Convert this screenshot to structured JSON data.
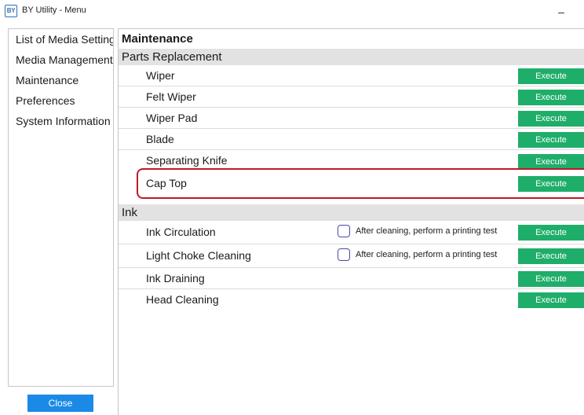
{
  "window": {
    "logo_text": "BY",
    "title": "BY Utility - Menu",
    "minimize_glyph": "–"
  },
  "sidebar": {
    "items": [
      {
        "label": "List of Media Settings"
      },
      {
        "label": "Media Management"
      },
      {
        "label": "Maintenance"
      },
      {
        "label": "Preferences"
      },
      {
        "label": "System Information"
      }
    ],
    "close_label": "Close"
  },
  "main": {
    "title": "Maintenance",
    "sections": [
      {
        "header": "Parts Replacement",
        "rows": [
          {
            "label": "Wiper",
            "button": "Execute"
          },
          {
            "label": "Felt Wiper",
            "button": "Execute"
          },
          {
            "label": "Wiper Pad",
            "button": "Execute"
          },
          {
            "label": "Blade",
            "button": "Execute"
          },
          {
            "label": "Separating Knife",
            "button": "Execute"
          },
          {
            "label": "Cap Top",
            "button": "Execute"
          }
        ]
      },
      {
        "header": "Ink",
        "rows": [
          {
            "label": "Ink Circulation",
            "checkbox_label": "After cleaning, perform a printing test",
            "checked": false,
            "button": "Execute"
          },
          {
            "label": "Light Choke Cleaning",
            "checkbox_label": "After cleaning, perform a printing test",
            "checked": false,
            "button": "Execute"
          },
          {
            "label": "Ink Draining",
            "button": "Execute"
          },
          {
            "label": "Head Cleaning",
            "button": "Execute"
          }
        ]
      }
    ]
  },
  "colors": {
    "execute_button": "#1fae6a",
    "close_button": "#1a8ae6",
    "highlight": "#c0182a",
    "section_header_bg": "#e2e2e2"
  }
}
